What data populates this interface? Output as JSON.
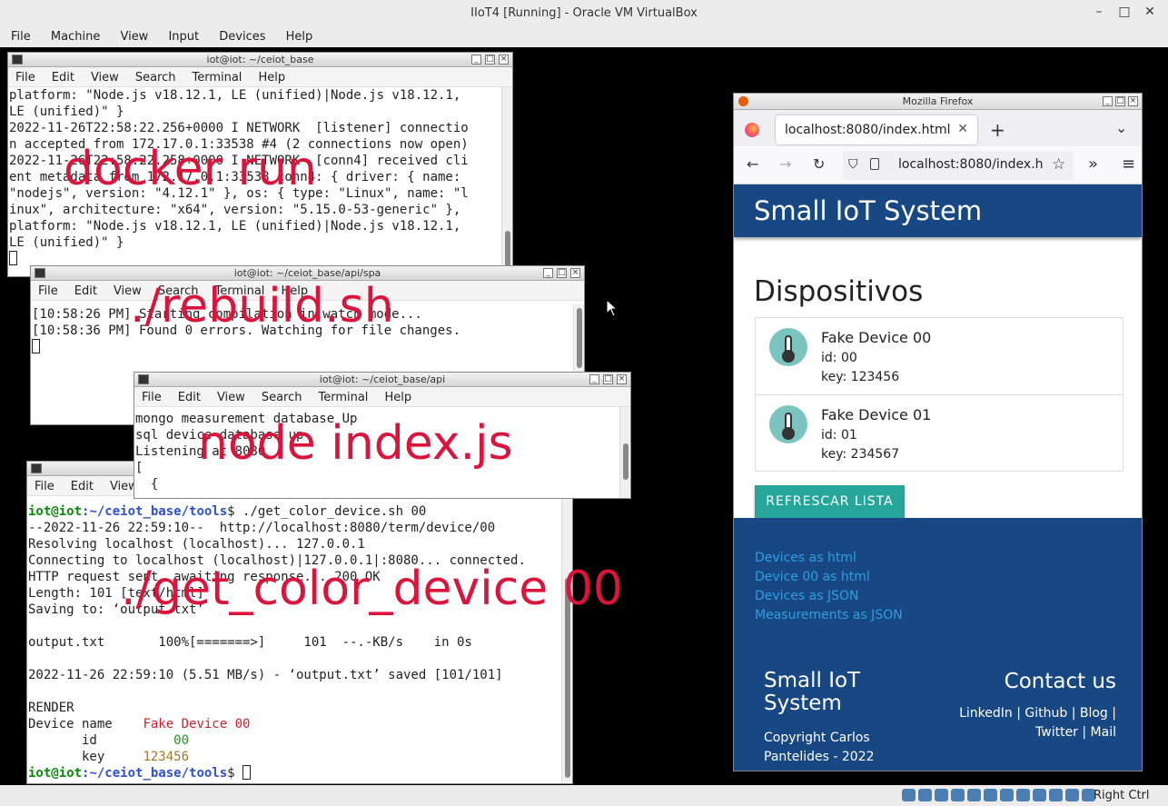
{
  "vbox": {
    "title": "IIoT4 [Running] - Oracle VM VirtualBox",
    "menu": [
      "File",
      "Machine",
      "View",
      "Input",
      "Devices",
      "Help"
    ],
    "controls": [
      "–",
      "□",
      "✕"
    ],
    "host_key": "Right Ctrl"
  },
  "term_menu": [
    "File",
    "Edit",
    "View",
    "Search",
    "Terminal",
    "Help"
  ],
  "term1": {
    "title": "iot@iot: ~/ceiot_base",
    "lines": [
      "platform: \"Node.js v18.12.1, LE (unified)|Node.js v18.12.1,",
      "LE (unified)\" }",
      "2022-11-26T22:58:22.256+0000 I NETWORK  [listener] connectio",
      "n accepted from 172.17.0.1:33538 #4 (2 connections now open)",
      "2022-11-26T22:58:22.258+0000 I NETWORK  [conn4] received cli",
      "ent metadata from 172.17.0.1:33538 conn4: { driver: { name:",
      "\"nodejs\", version: \"4.12.1\" }, os: { type: \"Linux\", name: \"l",
      "inux\", architecture: \"x64\", version: \"5.15.0-53-generic\" },",
      "platform: \"Node.js v18.12.1, LE (unified)|Node.js v18.12.1,",
      "LE (unified)\" }"
    ],
    "overlay": "docker run"
  },
  "term2": {
    "title": "iot@iot: ~/ceiot_base/api/spa",
    "lines": [
      "[10:58:26 PM] Starting compilation in watch mode...",
      "",
      "[10:58:36 PM] Found 0 errors. Watching for file changes.",
      ""
    ],
    "overlay": "./rebuild.sh"
  },
  "term3": {
    "title": "iot@iot: ~/ceiot_base/api",
    "lines": [
      "mongo measurement database Up",
      "sql device database up",
      "Listening at 8080",
      "[",
      "  {"
    ],
    "overlay": "node index.js"
  },
  "term4": {
    "prompt_user": "iot@iot",
    "prompt_path": ":~/ceiot_base/tools",
    "prompt_sign": "$ ",
    "command": "./get_color_device.sh 00",
    "lines": [
      "--2022-11-26 22:59:10--  http://localhost:8080/term/device/00",
      "Resolving localhost (localhost)... 127.0.0.1",
      "Connecting to localhost (localhost)|127.0.0.1|:8080... connected.",
      "HTTP request sent, awaiting response... 200 OK",
      "Length: 101 [text/html]",
      "Saving to: ‘output.txt’",
      "",
      "output.txt       100%[=======>]     101  --.-KB/s    in 0s",
      "",
      "2022-11-26 22:59:10 (5.51 MB/s) - ‘output.txt’ saved [101/101]",
      "",
      "RENDER"
    ],
    "render": {
      "name_label": "Device name    ",
      "name_value": "Fake Device 00",
      "id_label": "       id          ",
      "id_value": "00",
      "key_label": "       key     ",
      "key_value": "123456"
    },
    "overlay": "./get_color_device  00"
  },
  "firefox": {
    "window_title": "Mozilla Firefox",
    "tab_title": "localhost:8080/index.html",
    "url": "localhost:8080/index.h",
    "app_title": "Small IoT System",
    "heading": "Dispositivos",
    "devices": [
      {
        "name": "Fake Device 00",
        "id": "id: 00",
        "key": "key: 123456"
      },
      {
        "name": "Fake Device 01",
        "id": "id: 01",
        "key": "key: 234567"
      }
    ],
    "refresh_button": "REFRESCAR LISTA",
    "links": [
      "Devices as html",
      "Device 00 as html",
      "Devices as JSON",
      "Measurements as JSON"
    ],
    "footer_title": "Small IoT System",
    "footer_copyright": "Copyright Carlos Pantelides - 2022",
    "contact_title": "Contact us",
    "contact_links_1": "LinkedIn | Github | Blog |",
    "contact_links_2": "Twitter | Mail"
  }
}
